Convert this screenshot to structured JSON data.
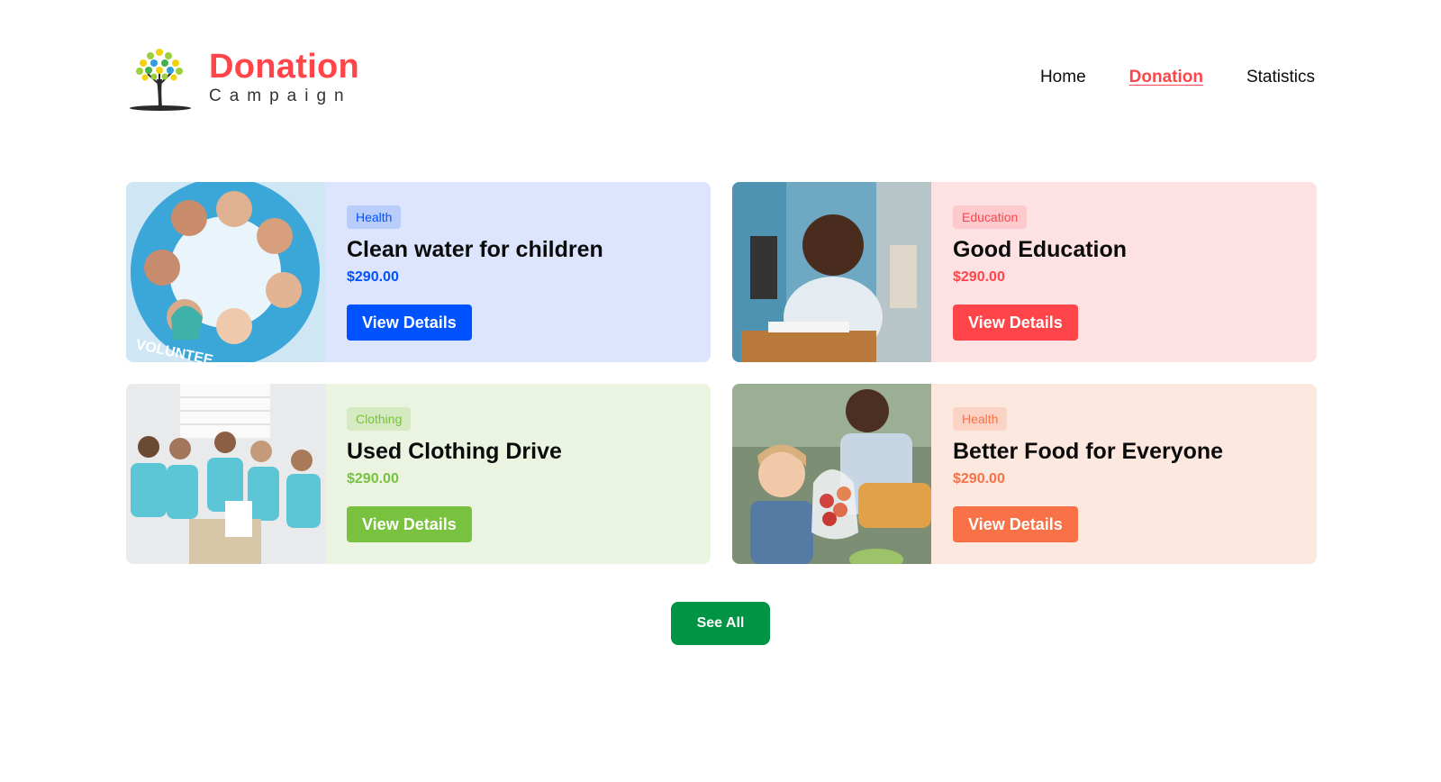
{
  "brand": {
    "title": "Donation",
    "subtitle": "Campaign"
  },
  "nav": {
    "home": "Home",
    "donation": "Donation",
    "statistics": "Statistics"
  },
  "cards": [
    {
      "category": "Health",
      "title": "Clean water for children",
      "price": "$290.00",
      "button": "View Details",
      "colors": {
        "card_bg": "#dce5fd",
        "tag_bg": "#b9cdfb",
        "accent": "#0052ff"
      }
    },
    {
      "category": "Education",
      "title": "Good Education",
      "price": "$290.00",
      "button": "View Details",
      "colors": {
        "card_bg": "#fee2e3",
        "tag_bg": "#fcc9cc",
        "accent": "#ff444a"
      }
    },
    {
      "category": "Clothing",
      "title": "Used Clothing Drive",
      "price": "$290.00",
      "button": "View Details",
      "colors": {
        "card_bg": "#eaf4e0",
        "tag_bg": "#d5eac0",
        "accent": "#79c23f"
      }
    },
    {
      "category": "Health",
      "title": "Better Food for Everyone",
      "price": "$290.00",
      "button": "View Details",
      "colors": {
        "card_bg": "#fde8e0",
        "tag_bg": "#fbd3c4",
        "accent": "#f87147"
      }
    }
  ],
  "see_all": "See All",
  "colors": {
    "brand": "#ff444a",
    "see_all": "#009444"
  }
}
